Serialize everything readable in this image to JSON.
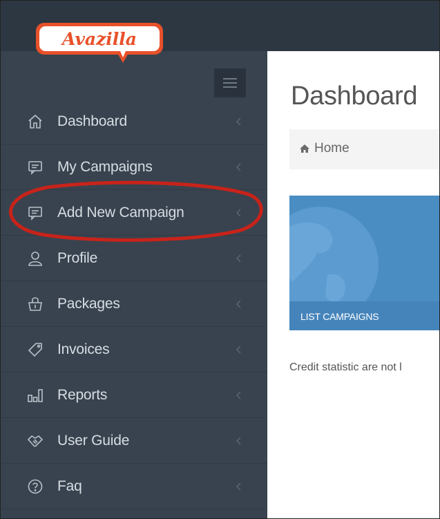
{
  "app": {
    "logo_text": "Avazilla"
  },
  "sidebar": {
    "items": [
      {
        "label": "Dashboard",
        "icon": "home-icon"
      },
      {
        "label": "My Campaigns",
        "icon": "message-icon"
      },
      {
        "label": "Add New Campaign",
        "icon": "message-icon"
      },
      {
        "label": "Profile",
        "icon": "user-icon"
      },
      {
        "label": "Packages",
        "icon": "bag-icon"
      },
      {
        "label": "Invoices",
        "icon": "tag-icon"
      },
      {
        "label": "Reports",
        "icon": "bar-chart-icon"
      },
      {
        "label": "User Guide",
        "icon": "handshake-icon"
      },
      {
        "label": "Faq",
        "icon": "question-icon"
      }
    ]
  },
  "main": {
    "title": "Dashboard",
    "breadcrumb": {
      "home": "Home"
    },
    "tile": {
      "label": "LIST CAMPAIGNS"
    },
    "credit_text": "Credit statistic are not l"
  },
  "colors": {
    "sidebar": "#38434f",
    "topbar": "#2c3742",
    "tile": "#4a8dc3",
    "annotation": "#c8231a",
    "logo": "#e8512a"
  }
}
